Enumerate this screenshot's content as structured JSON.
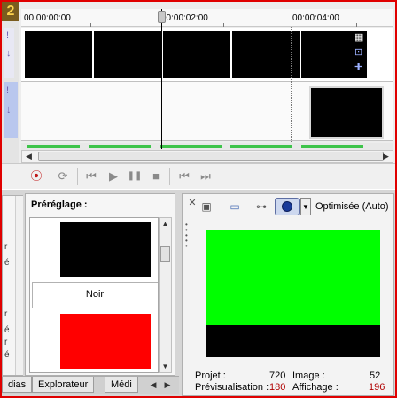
{
  "timeline": {
    "corner_badge": "2",
    "ruler": [
      "00:00:00:00",
      "00:00:02:00",
      "00:00:04:00"
    ],
    "left_glyphs": [
      "!",
      "↓",
      "!",
      "↓"
    ]
  },
  "transport": {
    "record": "⦿",
    "loop": "⟳",
    "play_start": "⏮",
    "play": "▶",
    "pause": "❚❚",
    "stop": "■",
    "prev_frame": "⏮",
    "next_frame": "⏭"
  },
  "left_sliver": {
    "chars": [
      "r",
      "é",
      "r",
      "é",
      "r",
      "é"
    ]
  },
  "preset_panel": {
    "title": "Préréglage :",
    "item_label": "Noir"
  },
  "tabs": [
    {
      "label": "dias"
    },
    {
      "label": "Explorateur"
    },
    {
      "label": "Médi"
    }
  ],
  "preview": {
    "quality_label": "Optimisée (Auto)",
    "stats": {
      "projet_label": "Projet :",
      "projet_value": "720",
      "image_label": "Image :",
      "image_value": "52",
      "previs_label": "Prévisualisation :",
      "previs_value": "180",
      "affichage_label": "Affichage :",
      "affichage_value": "196"
    }
  },
  "colors": {
    "frame": "#e00000",
    "preview_green": "#00ff00",
    "preset_red": "#ff0000",
    "red_value": "#b00000"
  }
}
